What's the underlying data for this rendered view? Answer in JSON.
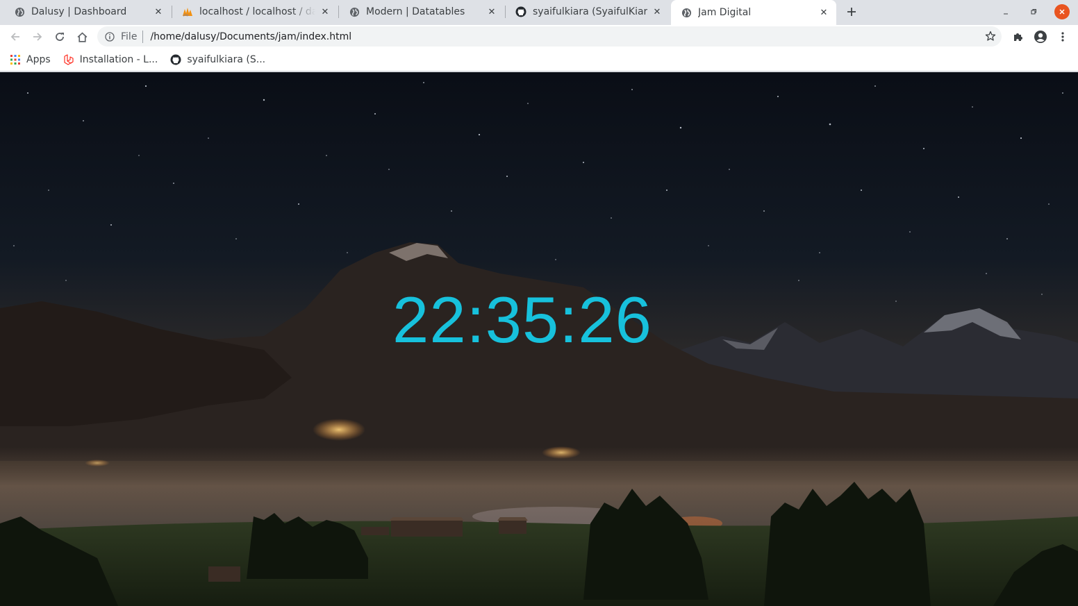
{
  "tabs": [
    {
      "title": "Dalusy | Dashboard",
      "favicon": "globe-icon",
      "active": false
    },
    {
      "title": "localhost / localhost / dalusy",
      "favicon": "phpmyadmin-icon",
      "active": false
    },
    {
      "title": "Modern | Datatables",
      "favicon": "globe-icon",
      "active": false
    },
    {
      "title": "syaifulkiara (SyaifulKiara)",
      "favicon": "github-icon",
      "active": false
    },
    {
      "title": "Jam Digital",
      "favicon": "globe-icon",
      "active": true
    }
  ],
  "toolbar": {
    "scheme_label": "File",
    "url": "/home/dalusy/Documents/jam/index.html"
  },
  "bookmarks": [
    {
      "label": "Apps",
      "icon": "apps-grid-icon"
    },
    {
      "label": "Installation - L...",
      "icon": "laravel-icon"
    },
    {
      "label": "syaifulkiara (S...",
      "icon": "github-icon"
    }
  ],
  "page": {
    "clock_text": "22:35:26",
    "clock_color": "#17c1dc"
  },
  "colors": {
    "tabstrip_bg": "#dee1e6",
    "close_button": "#e95420"
  }
}
